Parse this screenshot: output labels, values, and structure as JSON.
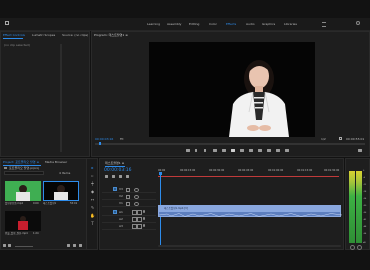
{
  "workspaces": [
    "Learning",
    "Assembly",
    "Editing",
    "Color",
    "Effects",
    "Audio",
    "Graphics",
    "Libraries"
  ],
  "active_workspace_index": 4,
  "effect_controls": {
    "tabs": [
      "Effect Controls",
      "Lumetri Scopes",
      "Source: (no clips)"
    ],
    "empty_text": "(no clip selected)"
  },
  "program": {
    "title": "Program: 테스트촬영1 ≡",
    "timecode": "00:00:03:16",
    "fit": "Fit",
    "quality": "1/2",
    "duration": "00:00:55:01"
  },
  "project": {
    "tabs": [
      "Project: 포트폴리오 촬영 ≡",
      "Media Browser"
    ],
    "path": "포트폴리오 촬영.prproj",
    "items_count": "4 Items",
    "bins": [
      {
        "name": "촬영본모음.mp4",
        "dur": "0:09"
      },
      {
        "name": "테스트촬영1",
        "dur": "55:01"
      },
      {
        "name": "인물_촬영_원본.mp4",
        "dur": "1:24"
      }
    ]
  },
  "timeline": {
    "title": "테스트촬영1 ≡",
    "timecode": "00:00:03:16",
    "ruler": [
      "00:00",
      "00:00:15:00",
      "00:00:30:00",
      "00:00:45:00",
      "00:01:00:00",
      "00:01:15:00",
      "00:01:30:00"
    ],
    "video_tracks": [
      "V3",
      "V2",
      "V1"
    ],
    "audio_tracks": [
      "A1",
      "A2",
      "A3"
    ],
    "clip_label": "테스트촬영1.mp4 [V]"
  },
  "meter": {
    "labels": [
      "0",
      "-6",
      "-12",
      "-18",
      "-24",
      "-30",
      "-36",
      "-42",
      "-48",
      "-54",
      "dB"
    ]
  },
  "colors": {
    "accent": "#2d8ceb",
    "clip_video": "#8aa8df",
    "clip_audio": "#5d7fbf",
    "playhead": "#2d8ceb",
    "meter_green": "#3cb043"
  }
}
